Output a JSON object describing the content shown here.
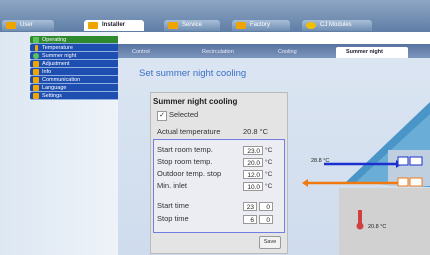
{
  "top_tabs": [
    {
      "label": "User",
      "color": "#f0a400"
    },
    {
      "label": "Installer",
      "color": "#f0a400"
    },
    {
      "label": "Service",
      "color": "#f0a400"
    },
    {
      "label": "Factory",
      "color": "#f0a400"
    },
    {
      "label": "CJ Modules",
      "color": "#f0c000"
    }
  ],
  "nav_items": [
    {
      "label": "Operating",
      "color": "#5cc05c"
    },
    {
      "label": "Temperature",
      "color": "#f0a400"
    },
    {
      "label": "Summer night",
      "color": "#5cc05c"
    },
    {
      "label": "Adjustment",
      "color": "#f0a400"
    },
    {
      "label": "Info",
      "color": "#f0a400"
    },
    {
      "label": "Communication",
      "color": "#f0a400"
    },
    {
      "label": "Language",
      "color": "#f0a400"
    },
    {
      "label": "Settings",
      "color": "#f0a400"
    }
  ],
  "sub_tabs": [
    "Control",
    "Recirculation",
    "Cooling",
    "Summer night"
  ],
  "page_title": "Set summer night cooling",
  "box": {
    "title": "Summer night cooling",
    "selected_label": "Selected",
    "actual_label": "Actual temperature",
    "actual_value": "20.8 °C"
  },
  "fields": [
    {
      "label": "Start room temp.",
      "value": "23.0",
      "unit": "°C"
    },
    {
      "label": "Stop room temp.",
      "value": "20.0",
      "unit": "°C"
    },
    {
      "label": "Outdoor temp. stop",
      "value": "12.0",
      "unit": "°C"
    },
    {
      "label": "Min. inlet",
      "value": "10.0",
      "unit": "°C"
    }
  ],
  "times": [
    {
      "label": "Start time",
      "h": "23",
      "m": "0"
    },
    {
      "label": "Stop time",
      "h": "6",
      "m": "0"
    }
  ],
  "save_label": "Save",
  "diagram": {
    "inlet_temp": "28.8 °C",
    "room_temp": "20.8 °C"
  },
  "colors": {
    "accent": "#3b6fc4",
    "nav": "#1e4fb0",
    "arrow_blue": "#1a2fd0",
    "arrow_orange": "#f07a10",
    "roof": "#4a95c8",
    "heater": "#d04040"
  }
}
